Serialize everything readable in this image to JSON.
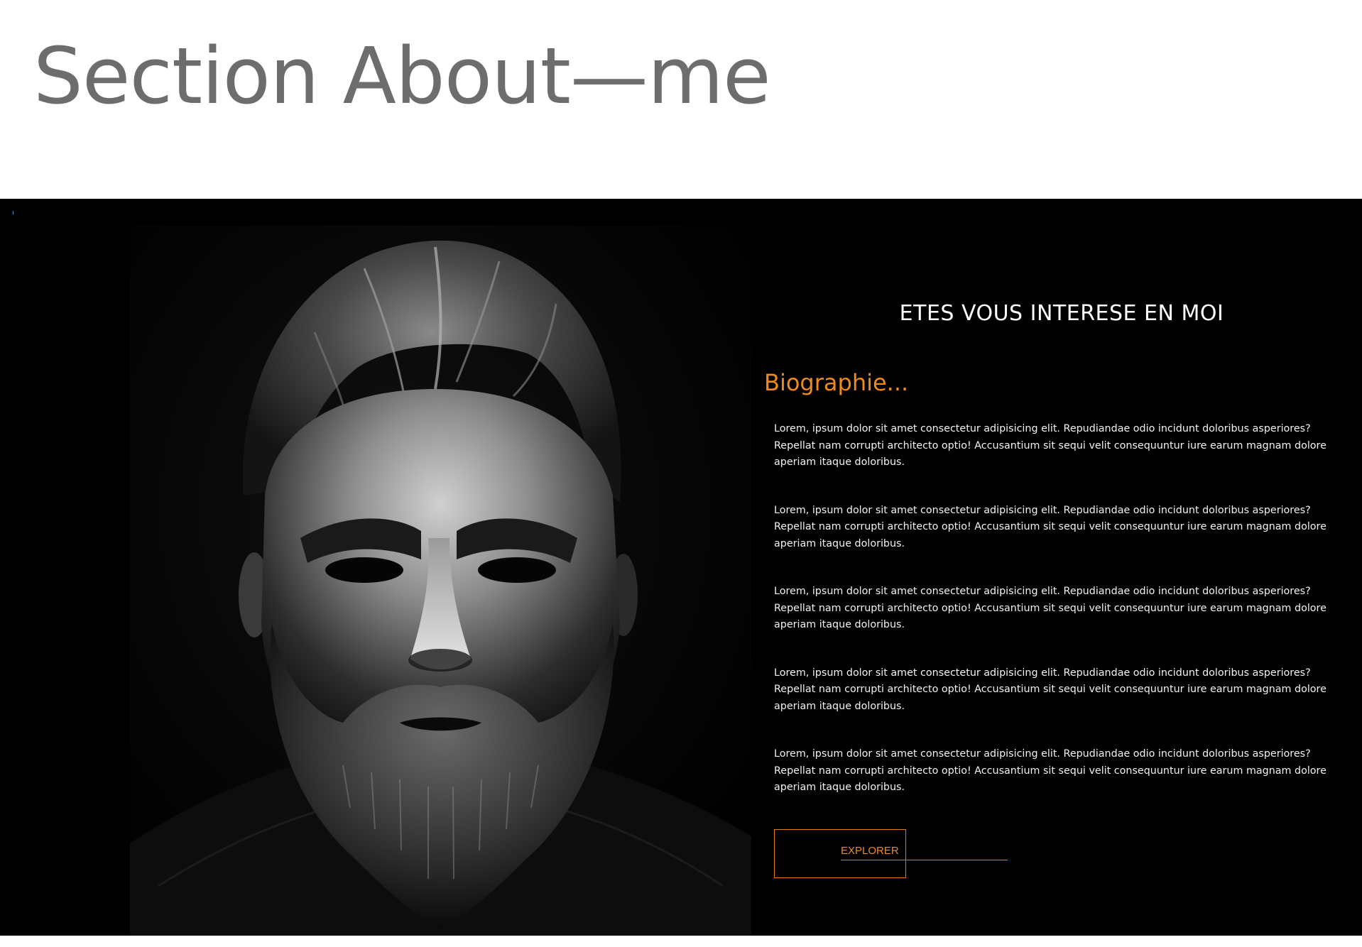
{
  "header": {
    "title": "Section About—me"
  },
  "about": {
    "headline": "ETES VOUS INTERESE EN MOI",
    "subtitle": "Biographie...",
    "paragraphs": [
      "Lorem, ipsum dolor sit amet consectetur adipisicing elit. Repudiandae odio incidunt doloribus asperiores? Repellat nam corrupti architecto optio! Accusantium sit sequi velit consequuntur iure earum magnam dolore aperiam itaque doloribus.",
      "Lorem, ipsum dolor sit amet consectetur adipisicing elit. Repudiandae odio incidunt doloribus asperiores? Repellat nam corrupti architecto optio! Accusantium sit sequi velit consequuntur iure earum magnam dolore aperiam itaque doloribus.",
      "Lorem, ipsum dolor sit amet consectetur adipisicing elit. Repudiandae odio incidunt doloribus asperiores? Repellat nam corrupti architecto optio! Accusantium sit sequi velit consequuntur iure earum magnam dolore aperiam itaque doloribus.",
      "Lorem, ipsum dolor sit amet consectetur adipisicing elit. Repudiandae odio incidunt doloribus asperiores? Repellat nam corrupti architecto optio! Accusantium sit sequi velit consequuntur iure earum magnam dolore aperiam itaque doloribus.",
      "Lorem, ipsum dolor sit amet consectetur adipisicing elit. Repudiandae odio incidunt doloribus asperiores? Repellat nam corrupti architecto optio! Accusantium sit sequi velit consequuntur iure earum magnam dolore aperiam itaque doloribus."
    ],
    "button_label": "EXPLORER"
  },
  "colors": {
    "background": "#000000",
    "accent": "#ee8a1c",
    "title_gray": "#6d6d6d",
    "body_text": "#f2f2f2"
  },
  "icons": {
    "portrait": "bearded-man-portrait-photo"
  }
}
